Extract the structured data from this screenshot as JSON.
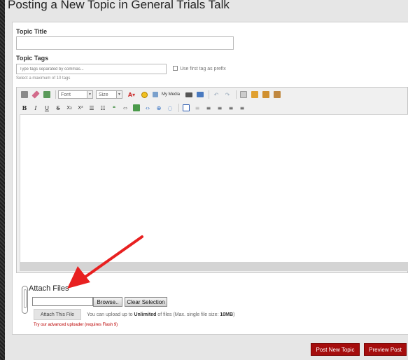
{
  "page": {
    "title": "Posting a New Topic in General Trials Talk"
  },
  "form": {
    "topic_title_label": "Topic Title",
    "topic_title_value": "",
    "topic_tags_label": "Topic Tags",
    "tags_placeholder": "Type tags separated by commas...",
    "use_first_tag_label": "Use first tag as prefix",
    "tags_hint": "Select a maximum of 10 tags"
  },
  "editor": {
    "font_select": "Font",
    "size_select": "Size",
    "my_media_label": "My Media",
    "bold": "B",
    "italic": "I",
    "underline": "U",
    "strike": "S",
    "subscript": "X₂",
    "superscript": "X²"
  },
  "attachments": {
    "title": "Attach Files",
    "browse_button": "Browse..",
    "clear_button": "Clear Selection",
    "attach_button": "Attach This File",
    "info_prefix": "You can upload up to ",
    "info_unlimited": "Unlimited",
    "info_middle": " of files (Max. single file size: ",
    "info_size": "10MB",
    "info_suffix": ")",
    "advanced_link": "Try our advanced uploader (requires Flash 9)"
  },
  "actions": {
    "post_button": "Post New Topic",
    "preview_button": "Preview Post"
  },
  "colors": {
    "primary_button": "#a50d0d",
    "arrow": "#e82020",
    "flash_link": "#bb0000"
  }
}
